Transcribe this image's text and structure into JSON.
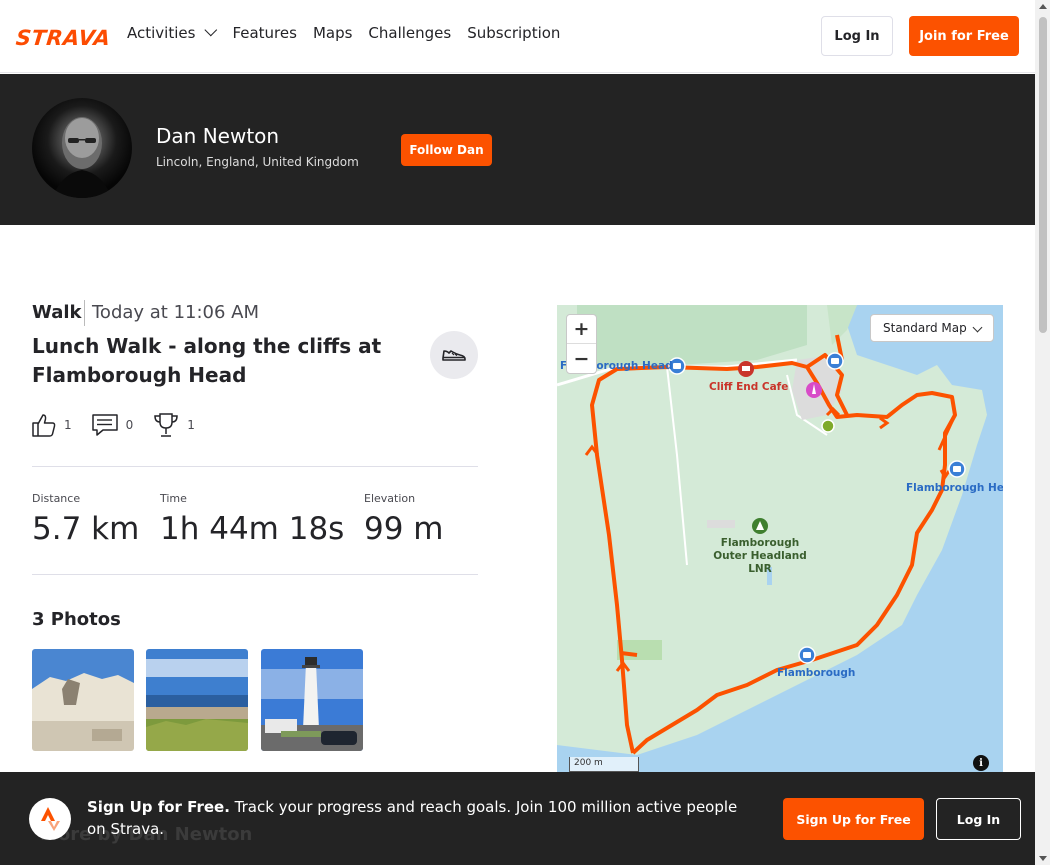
{
  "nav": {
    "logo": "STRAVA",
    "links": [
      "Activities",
      "Features",
      "Maps",
      "Challenges",
      "Subscription"
    ],
    "login_label": "Log In",
    "join_label": "Join for Free"
  },
  "athlete": {
    "name": "Dan Newton",
    "location": "Lincoln, England, United Kingdom",
    "follow_label": "Follow Dan"
  },
  "activity": {
    "type": "Walk",
    "time": "Today at 11:06 AM",
    "title": "Lunch Walk - along the cliffs at Flamborough Head",
    "kudos": "1",
    "comments": "0",
    "achievements": "1",
    "stats": [
      {
        "label": "Distance",
        "value": "5.7 km"
      },
      {
        "label": "Time",
        "value": "1h 44m 18s"
      },
      {
        "label": "Elevation",
        "value": "99 m"
      }
    ],
    "photos_title": "3 Photos"
  },
  "map": {
    "style_select": "Standard Map",
    "zoom_in": "+",
    "zoom_out": "−",
    "scale": "200 m",
    "info": "i",
    "labels": {
      "flamborough_head_w": "Flamborough Head",
      "cafe": "Cliff End Cafe",
      "flamborough_head_e": "Flamborough Head",
      "reserve": "Flamborough Outer Headland LNR",
      "flamborough": "Flamborough"
    }
  },
  "signup": {
    "bold": "Sign Up for Free.",
    "text": " Track your progress and reach goals. Join 100 million active people on Strava.",
    "button": "Sign Up for Free",
    "login": "Log In",
    "behind_heading": "More by Dan Newton"
  },
  "colors": {
    "brand": "#fc5200",
    "banner": "#232323",
    "route": "#fc5200"
  }
}
